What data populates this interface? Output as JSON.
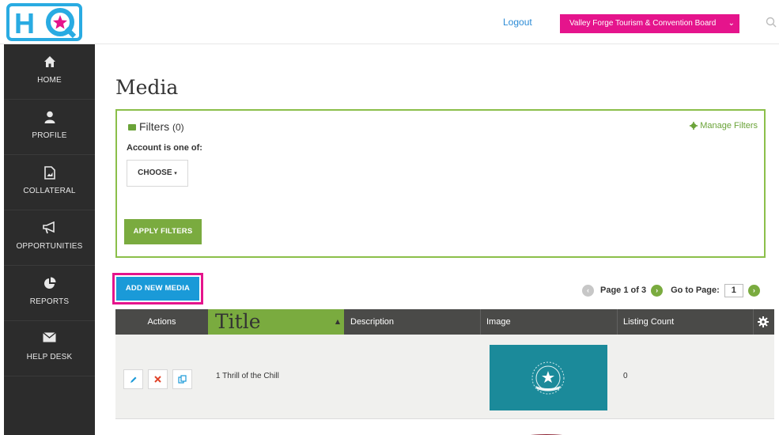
{
  "header": {
    "logo_text": "HQ",
    "logout_label": "Logout",
    "org_select_value": "Valley Forge Tourism & Convention Board"
  },
  "sidebar": {
    "items": [
      {
        "label": "HOME",
        "icon": "home-icon"
      },
      {
        "label": "PROFILE",
        "icon": "user-icon"
      },
      {
        "label": "COLLATERAL",
        "icon": "document-icon"
      },
      {
        "label": "OPPORTUNITIES",
        "icon": "megaphone-icon"
      },
      {
        "label": "REPORTS",
        "icon": "pie-chart-icon"
      },
      {
        "label": "HELP DESK",
        "icon": "envelope-icon"
      }
    ]
  },
  "main": {
    "page_title": "Media",
    "filters": {
      "title": "Filters",
      "count": "(0)",
      "manage_label": "Manage Filters",
      "account_label": "Account is one of:",
      "choose_label": "CHOOSE",
      "apply_label": "APPLY FILTERS"
    },
    "add_new_label": "ADD NEW MEDIA",
    "pagination": {
      "page_text": "Page 1 of 3",
      "goto_label": "Go to Page:",
      "page_value": "1"
    },
    "table": {
      "columns": [
        "Actions",
        "Title",
        "Description",
        "Image",
        "Listing Count"
      ],
      "sort_indicator": "▲",
      "rows": [
        {
          "title": "1 Thrill of the Chill",
          "description": "",
          "listing_count": "0"
        }
      ]
    }
  },
  "colors": {
    "brand_pink": "#e5148c",
    "accent_green": "#7aab3f",
    "button_blue": "#1a9ad8",
    "sidebar_bg": "#2c2c2c",
    "logo_blue": "#29abe2"
  }
}
